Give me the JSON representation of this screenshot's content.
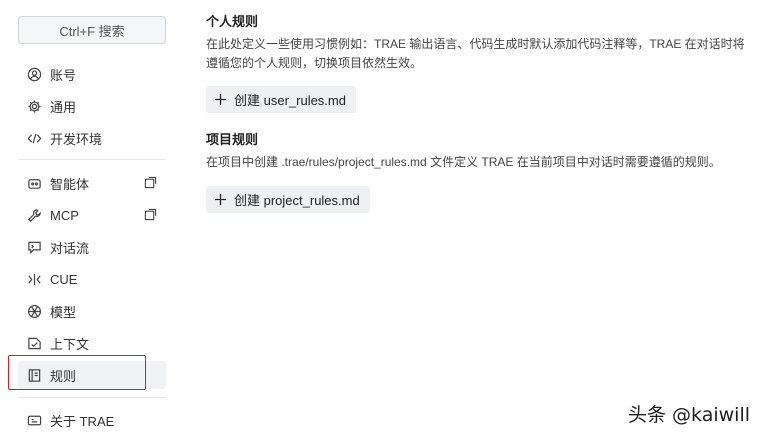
{
  "sidebar": {
    "search_label": "Ctrl+F 搜索",
    "items": [
      {
        "label": "账号",
        "icon": "user-circle-icon"
      },
      {
        "label": "通用",
        "icon": "gear-icon"
      },
      {
        "label": "开发环境",
        "icon": "code-icon"
      },
      {
        "label": "智能体",
        "icon": "robot-icon"
      },
      {
        "label": "MCP",
        "icon": "wrench-icon"
      },
      {
        "label": "对话流",
        "icon": "chat-icon"
      },
      {
        "label": "CUE",
        "icon": "cue-icon"
      },
      {
        "label": "模型",
        "icon": "model-icon"
      },
      {
        "label": "上下文",
        "icon": "context-icon"
      },
      {
        "label": "规则",
        "icon": "rules-book-icon"
      },
      {
        "label": "关于 TRAE",
        "icon": "info-icon"
      }
    ]
  },
  "main": {
    "personal": {
      "title": "个人规则",
      "desc_line1": "在此处定义一些使用习惯例如：TRAE 输出语言、代码生成时默认添加代码注释等，TRAE 在对话时将",
      "desc_line2": "遵循您的个人规则，切换项目依然生效。",
      "button": "创建 user_rules.md"
    },
    "project": {
      "title": "项目规则",
      "desc": "在项目中创建 .trae/rules/project_rules.md 文件定义 TRAE 在当前项目中对话时需要遵循的规则。",
      "button": "创建 project_rules.md"
    }
  },
  "watermark": "头条 @kaiwill",
  "colors": {
    "highlight": "#d0202a",
    "active_bg": "#f1f2f4",
    "button_bg": "#eef0f2"
  }
}
